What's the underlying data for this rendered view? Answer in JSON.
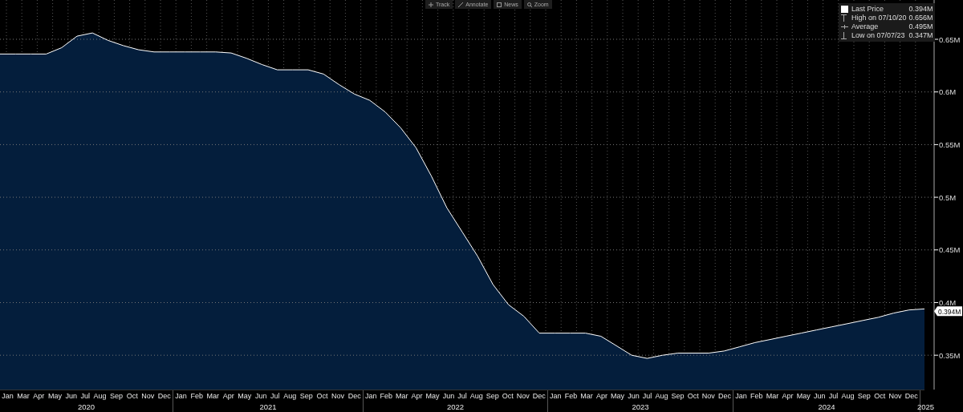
{
  "toolbar": [
    {
      "label": "Track"
    },
    {
      "label": "Annotate"
    },
    {
      "label": "News"
    },
    {
      "label": "Zoom"
    }
  ],
  "legend": [
    {
      "kind": "last",
      "value": "0.394M"
    },
    {
      "kind": "high",
      "label": "High on 07/10/20",
      "value": "0.656M"
    },
    {
      "kind": "average",
      "label": "Average",
      "value": "0.495M"
    },
    {
      "kind": "low",
      "label": "Low on 07/07/23",
      "value": "0.347M"
    }
  ],
  "chart_data": {
    "type": "area",
    "grid": true,
    "ylim": [
      0.3174,
      0.6873
    ],
    "yticks": [
      {
        "value": 0.35,
        "label": "0.35M"
      },
      {
        "value": 0.4,
        "label": "0.4M"
      },
      {
        "value": 0.45,
        "label": "0.45M"
      },
      {
        "value": 0.5,
        "label": "0.5M"
      },
      {
        "value": 0.55,
        "label": "0.55M"
      },
      {
        "value": 0.6,
        "label": "0.6M"
      },
      {
        "value": 0.65,
        "label": "0.65M"
      }
    ],
    "series": [
      {
        "name": "Last Price",
        "color": "#ffffff",
        "values": [
          0.636,
          0.636,
          0.636,
          0.636,
          0.642,
          0.653,
          0.656,
          0.649,
          0.644,
          0.64,
          0.638,
          0.638,
          0.638,
          0.638,
          0.638,
          0.637,
          0.632,
          0.626,
          0.621,
          0.621,
          0.621,
          0.617,
          0.607,
          0.598,
          0.592,
          0.581,
          0.566,
          0.547,
          0.52,
          0.49,
          0.467,
          0.444,
          0.417,
          0.398,
          0.387,
          0.371,
          0.371,
          0.371,
          0.371,
          0.368,
          0.359,
          0.35,
          0.347,
          0.35,
          0.352,
          0.352,
          0.352,
          0.354,
          0.358,
          0.362,
          0.365,
          0.368,
          0.371,
          0.374,
          0.377,
          0.38,
          0.383,
          0.386,
          0.39,
          0.393,
          0.394
        ]
      }
    ],
    "annotations": [
      "0.394M"
    ]
  },
  "x_axis": {
    "years": [
      {
        "label": "2020",
        "months": [
          "Jan",
          "Mar",
          "Apr",
          "May",
          "Jun",
          "Jul",
          "Aug",
          "Sep",
          "Oct",
          "Nov",
          "Dec"
        ]
      },
      {
        "label": "2021",
        "months": [
          "Jan",
          "Feb",
          "Mar",
          "Apr",
          "May",
          "Jun",
          "Jul",
          "Aug",
          "Sep",
          "Oct",
          "Nov",
          "Dec"
        ]
      },
      {
        "label": "2022",
        "months": [
          "Jan",
          "Feb",
          "Mar",
          "Apr",
          "May",
          "Jun",
          "Jul",
          "Aug",
          "Sep",
          "Oct",
          "Nov",
          "Dec"
        ]
      },
      {
        "label": "2023",
        "months": [
          "Jan",
          "Feb",
          "Mar",
          "Apr",
          "May",
          "Jun",
          "Jul",
          "Aug",
          "Sep",
          "Oct",
          "Nov",
          "Dec"
        ]
      },
      {
        "label": "2024",
        "months": [
          "Jan",
          "Feb",
          "Mar",
          "Apr",
          "May",
          "Jun",
          "Jul",
          "Aug",
          "Sep",
          "Oct",
          "Nov",
          "Dec"
        ]
      },
      {
        "label": "2025"
      }
    ]
  }
}
